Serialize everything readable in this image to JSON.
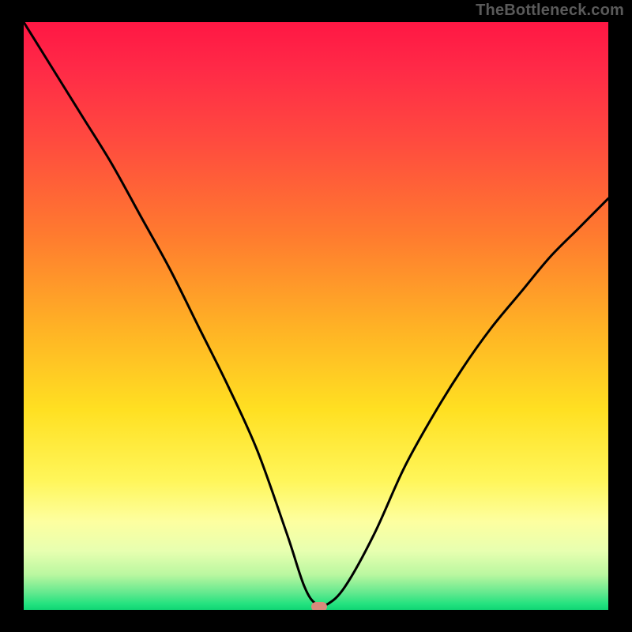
{
  "watermark": "TheBottleneck.com",
  "colors": {
    "gradient_top": "#ff1744",
    "gradient_mid": "#ffe022",
    "gradient_low": "#fdffa0",
    "gradient_bottom": "#10d574",
    "curve": "#000000",
    "frame": "#000000",
    "marker": "#d88a7b"
  },
  "chart_data": {
    "type": "line",
    "title": "",
    "xlabel": "",
    "ylabel": "",
    "xlim": [
      0,
      100
    ],
    "ylim": [
      0,
      100
    ],
    "grid": false,
    "legend": false,
    "annotations": [
      "TheBottleneck.com"
    ],
    "series": [
      {
        "name": "bottleneck-curve",
        "x": [
          0,
          5,
          10,
          15,
          20,
          25,
          30,
          35,
          40,
          45,
          48,
          50,
          52,
          55,
          60,
          65,
          70,
          75,
          80,
          85,
          90,
          95,
          100
        ],
        "y": [
          100,
          92,
          84,
          76,
          67,
          58,
          48,
          38,
          27,
          13,
          4,
          1,
          1,
          4,
          13,
          24,
          33,
          41,
          48,
          54,
          60,
          65,
          70
        ]
      }
    ],
    "marker": {
      "x": 50.5,
      "y": 0.5
    }
  }
}
